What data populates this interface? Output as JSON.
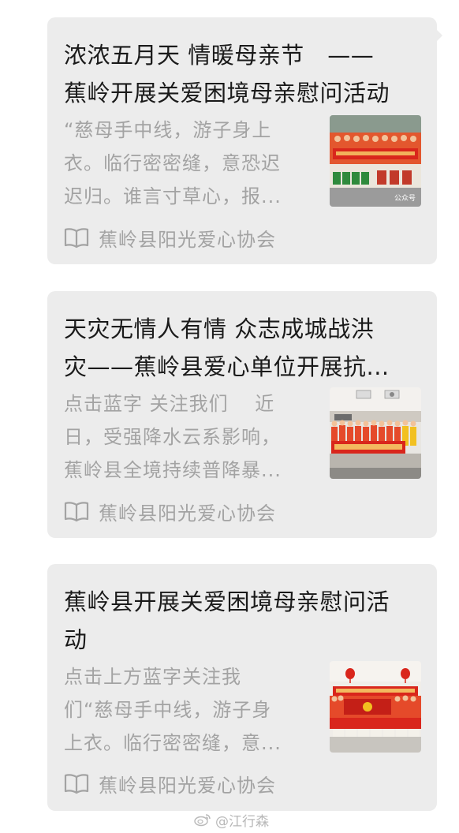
{
  "cards": [
    {
      "title_lines": [
        "浓浓五月天 情暖母亲节　——",
        "蕉岭开展关爱困境母亲慰问活动"
      ],
      "desc_lines": [
        "“慈母手中线，游子身上",
        "衣。临行密密缝，意恐迟",
        "迟归。谁言寸草心，报..."
      ],
      "source": "蕉岭县阳光爱心协会",
      "thumb_overlay": "公众号"
    },
    {
      "title_lines": [
        "天灾无情人有情 众志成城战洪",
        "灾——蕉岭县爱心单位开展抗..."
      ],
      "desc_lines": [
        "点击蓝字 关注我们　 近",
        "日，受强降水云系影响，",
        "蕉岭县全境持续普降暴..."
      ],
      "source": "蕉岭县阳光爱心协会",
      "thumb_overlay": ""
    },
    {
      "title_lines": [
        "蕉岭县开展关爱困境母亲慰问活",
        "动"
      ],
      "desc_lines": [
        "点击上方蓝字关注我",
        "们“慈母手中线，游子身",
        "上衣。临行密密缝，意..."
      ],
      "source": "蕉岭县阳光爱心协会",
      "thumb_overlay": ""
    }
  ],
  "watermark": "@江行森",
  "colors": {
    "card_bg": "#ececec",
    "title": "#1a1a1a",
    "muted": "#a3a3a3",
    "banner_red": "#d9261c"
  }
}
